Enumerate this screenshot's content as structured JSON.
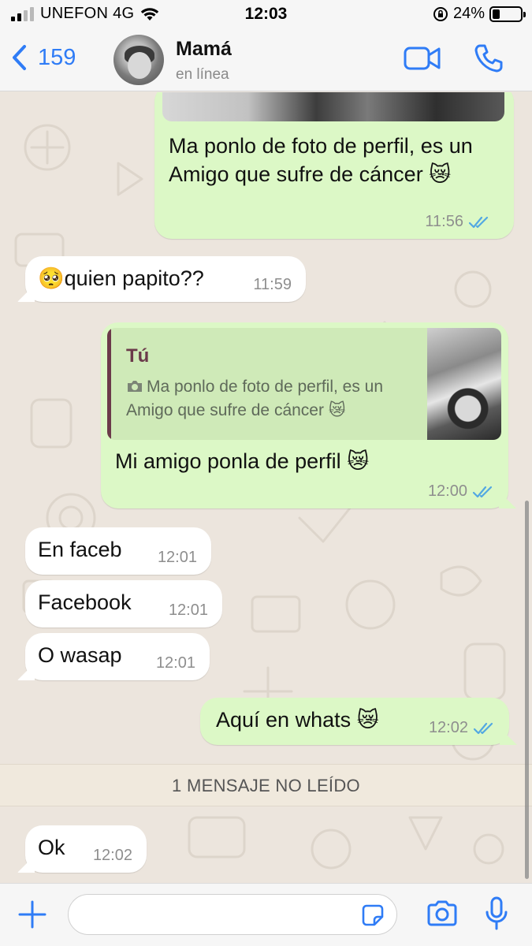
{
  "status_bar": {
    "carrier": "UNEFON 4G",
    "time": "12:03",
    "battery": "24%"
  },
  "header": {
    "back_count": "159",
    "contact_name": "Mamá",
    "contact_status": "en línea"
  },
  "messages": [
    {
      "direction": "out",
      "text": "Ma ponlo de foto de perfil, es un Amigo que sufre de cáncer 😿",
      "time": "11:56"
    },
    {
      "direction": "in",
      "text": "🥺quien papito??",
      "time": "11:59"
    },
    {
      "direction": "out",
      "quote_author": "Tú",
      "quote_text": "Ma ponlo de foto de perfil, es un Amigo que sufre de cáncer 😿",
      "text": "Mi amigo ponla de perfil 😿",
      "time": "12:00"
    },
    {
      "direction": "in",
      "text": "En faceb",
      "time": "12:01"
    },
    {
      "direction": "in",
      "text": "Facebook",
      "time": "12:01"
    },
    {
      "direction": "in",
      "text": "O wasap",
      "time": "12:01"
    },
    {
      "direction": "out",
      "text": "Aquí en whats 😿",
      "time": "12:02"
    },
    {
      "direction": "in",
      "text": "Ok",
      "time": "12:02"
    }
  ],
  "unread_banner": "1 MENSAJE NO LEÍDO",
  "colors": {
    "accent": "#2f7cf6",
    "outgoing_bubble": "#dcf8c6",
    "incoming_bubble": "#ffffff",
    "read_ticks": "#53a8e2",
    "chat_background": "#ece5dd"
  },
  "icons": {
    "back": "chevron-left-icon",
    "video": "video-call-icon",
    "phone": "phone-icon",
    "attach": "plus-icon",
    "sticker": "sticker-icon",
    "camera": "camera-icon",
    "mic": "microphone-icon"
  }
}
